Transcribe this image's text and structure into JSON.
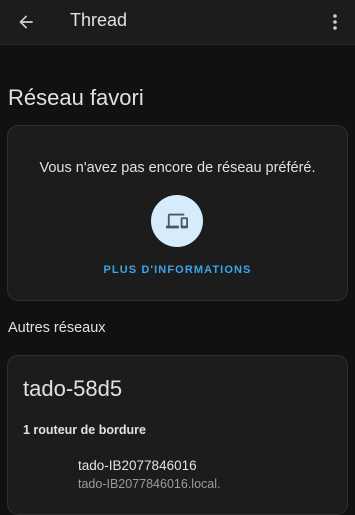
{
  "app_bar": {
    "title": "Thread",
    "back_icon": "arrow-left-icon",
    "menu_icon": "more-vertical-icon"
  },
  "preferred_network": {
    "heading": "Réseau favori",
    "empty_message": "Vous n'avez pas encore de réseau préféré.",
    "icon": "thread-devices-icon",
    "more_info_label": "PLUS D'INFORMATIONS"
  },
  "other_networks": {
    "heading": "Autres réseaux",
    "networks": [
      {
        "name": "tado-58d5",
        "router_count_label": "1 routeur de bordure",
        "routers": [
          {
            "name": "tado-IB2077846016",
            "host": "tado-IB2077846016.local."
          }
        ]
      }
    ]
  },
  "colors": {
    "background": "#111111",
    "card": "#1c1c1c",
    "accent": "#3ea5e8",
    "icon_circle": "#d7ecfb",
    "primary_text": "#e1e1e1",
    "secondary_text": "#9b9b9b"
  }
}
